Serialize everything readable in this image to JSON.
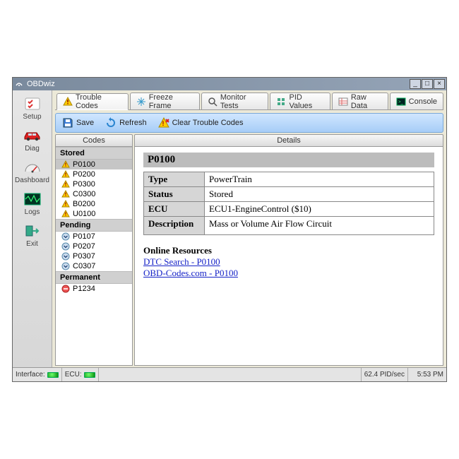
{
  "window": {
    "title": "OBDwiz"
  },
  "sidebar": [
    {
      "name": "setup",
      "label": "Setup"
    },
    {
      "name": "diag",
      "label": "Diag"
    },
    {
      "name": "dashboard",
      "label": "Dashboard"
    },
    {
      "name": "logs",
      "label": "Logs"
    },
    {
      "name": "exit",
      "label": "Exit"
    }
  ],
  "tabs": [
    {
      "name": "trouble-codes",
      "label": "Trouble Codes",
      "active": true
    },
    {
      "name": "freeze-frame",
      "label": "Freeze Frame"
    },
    {
      "name": "monitor-tests",
      "label": "Monitor Tests"
    },
    {
      "name": "pid-values",
      "label": "PID Values"
    },
    {
      "name": "raw-data",
      "label": "Raw Data"
    },
    {
      "name": "console",
      "label": "Console"
    }
  ],
  "toolbar": {
    "save": "Save",
    "refresh": "Refresh",
    "clear": "Clear Trouble Codes"
  },
  "columns": {
    "codes": "Codes",
    "details": "Details"
  },
  "codes": {
    "groupStored": "Stored",
    "groupPending": "Pending",
    "groupPermanent": "Permanent",
    "stored": [
      "P0100",
      "P0200",
      "P0300",
      "C0300",
      "B0200",
      "U0100"
    ],
    "pending": [
      "P0107",
      "P0207",
      "P0307",
      "C0307"
    ],
    "permanent": [
      "P1234"
    ],
    "selected": "P0100"
  },
  "details": {
    "code": "P0100",
    "rows": {
      "typeLabel": "Type",
      "typeValue": "PowerTrain",
      "statusLabel": "Status",
      "statusValue": "Stored",
      "ecuLabel": "ECU",
      "ecuValue": "ECU1-EngineControl ($10)",
      "descLabel": "Description",
      "descValue": "Mass or Volume Air Flow Circuit"
    },
    "onlineHeader": "Online Resources",
    "links": [
      "DTC Search - P0100",
      "OBD-Codes.com - P0100"
    ]
  },
  "status": {
    "interfaceLabel": "Interface:",
    "ecuLabel": "ECU:",
    "pidRate": "62.4 PID/sec",
    "time": "5:53 PM"
  }
}
